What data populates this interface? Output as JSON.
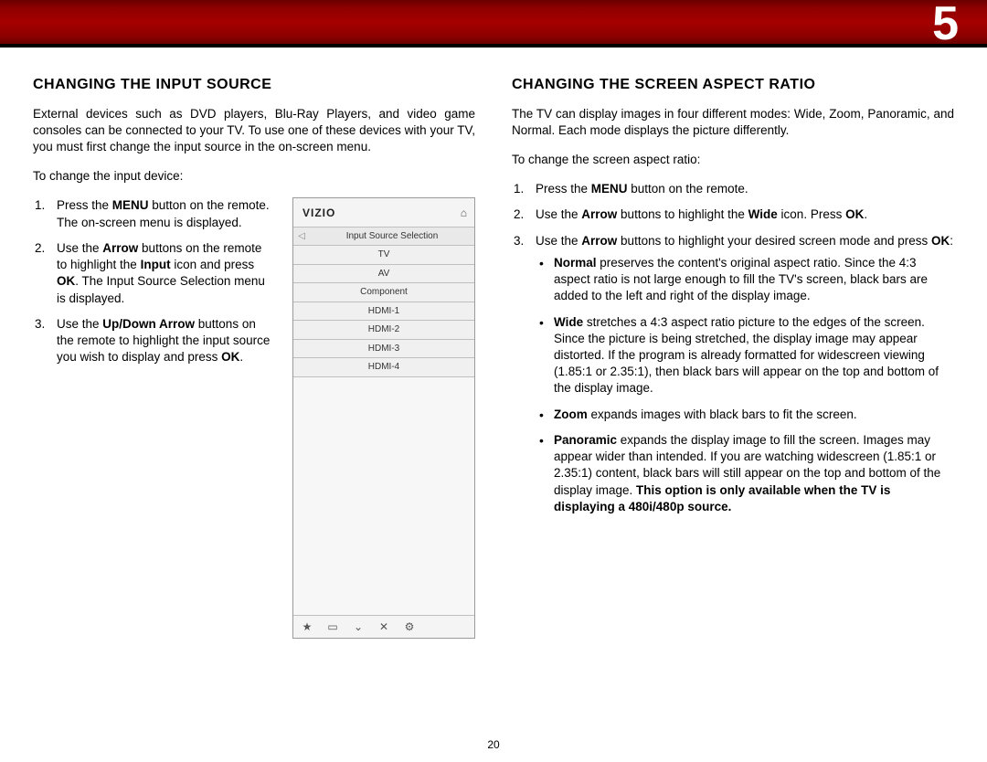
{
  "chapter_number": "5",
  "page_number": "20",
  "left": {
    "heading": "CHANGING THE INPUT SOURCE",
    "intro": "External devices such as DVD players, Blu-Ray Players, and video game consoles can be connected to your TV. To use one of these devices with your TV, you must first change the input source in the on-screen menu.",
    "lead_in": "To change the input device:",
    "step1_a": "Press the ",
    "step1_b": "MENU",
    "step1_c": " button on the remote. The on-screen menu is displayed.",
    "step2_a": "Use the ",
    "step2_b": "Arrow",
    "step2_c": " buttons on the remote to highlight the ",
    "step2_d": "Input",
    "step2_e": " icon and press ",
    "step2_f": "OK",
    "step2_g": ". The Input Source Selection menu is displayed.",
    "step3_a": "Use the ",
    "step3_b": "Up/Down Arrow",
    "step3_c": " buttons on the remote to highlight the input source you wish to display and press ",
    "step3_d": "OK",
    "step3_e": "."
  },
  "menu": {
    "brand": "VIZIO",
    "home_icon": "⌂",
    "back_icon": "◁",
    "title": "Input Source Selection",
    "items": [
      "TV",
      "AV",
      "Component",
      "HDMI-1",
      "HDMI-2",
      "HDMI-3",
      "HDMI-4"
    ],
    "footer": [
      "★",
      "▭",
      "⌄",
      "✕",
      "⚙"
    ]
  },
  "right": {
    "heading": "CHANGING THE SCREEN ASPECT RATIO",
    "intro": "The TV can display images in four different modes: Wide, Zoom, Panoramic, and Normal. Each mode displays the picture differently.",
    "lead_in": "To change the screen aspect ratio:",
    "step1_a": "Press the ",
    "step1_b": "MENU",
    "step1_c": " button on the remote.",
    "step2_a": "Use the ",
    "step2_b": "Arrow",
    "step2_c": " buttons to highlight the ",
    "step2_d": "Wide",
    "step2_e": " icon. Press ",
    "step2_f": "OK",
    "step2_g": ".",
    "step3_a": "Use the ",
    "step3_b": "Arrow",
    "step3_c": " buttons to highlight your desired screen mode and press ",
    "step3_d": "OK",
    "step3_e": ":",
    "b1_a": "Normal",
    "b1_b": " preserves the content's original aspect ratio. Since the 4:3 aspect ratio is not large enough to fill the TV's screen, black bars are added to the left and right of the display image.",
    "b2_a": "Wide",
    "b2_b": " stretches a 4:3 aspect ratio picture to the edges of the screen. Since the picture is being stretched, the display image may appear distorted. If the program is already formatted for widescreen viewing (1.85:1 or 2.35:1), then black bars will appear on the top and bottom of the display image.",
    "b3_a": "Zoom",
    "b3_b": " expands images with black bars to fit the screen.",
    "b4_a": "Panoramic",
    "b4_b": " expands the display image to fill the screen. Images may appear wider than intended. If you are watching widescreen (1.85:1 or 2.35:1) content, black bars will still appear on the top and bottom of the display image. ",
    "b4_c": "This option is only available when the TV is displaying a 480i/480p source."
  }
}
